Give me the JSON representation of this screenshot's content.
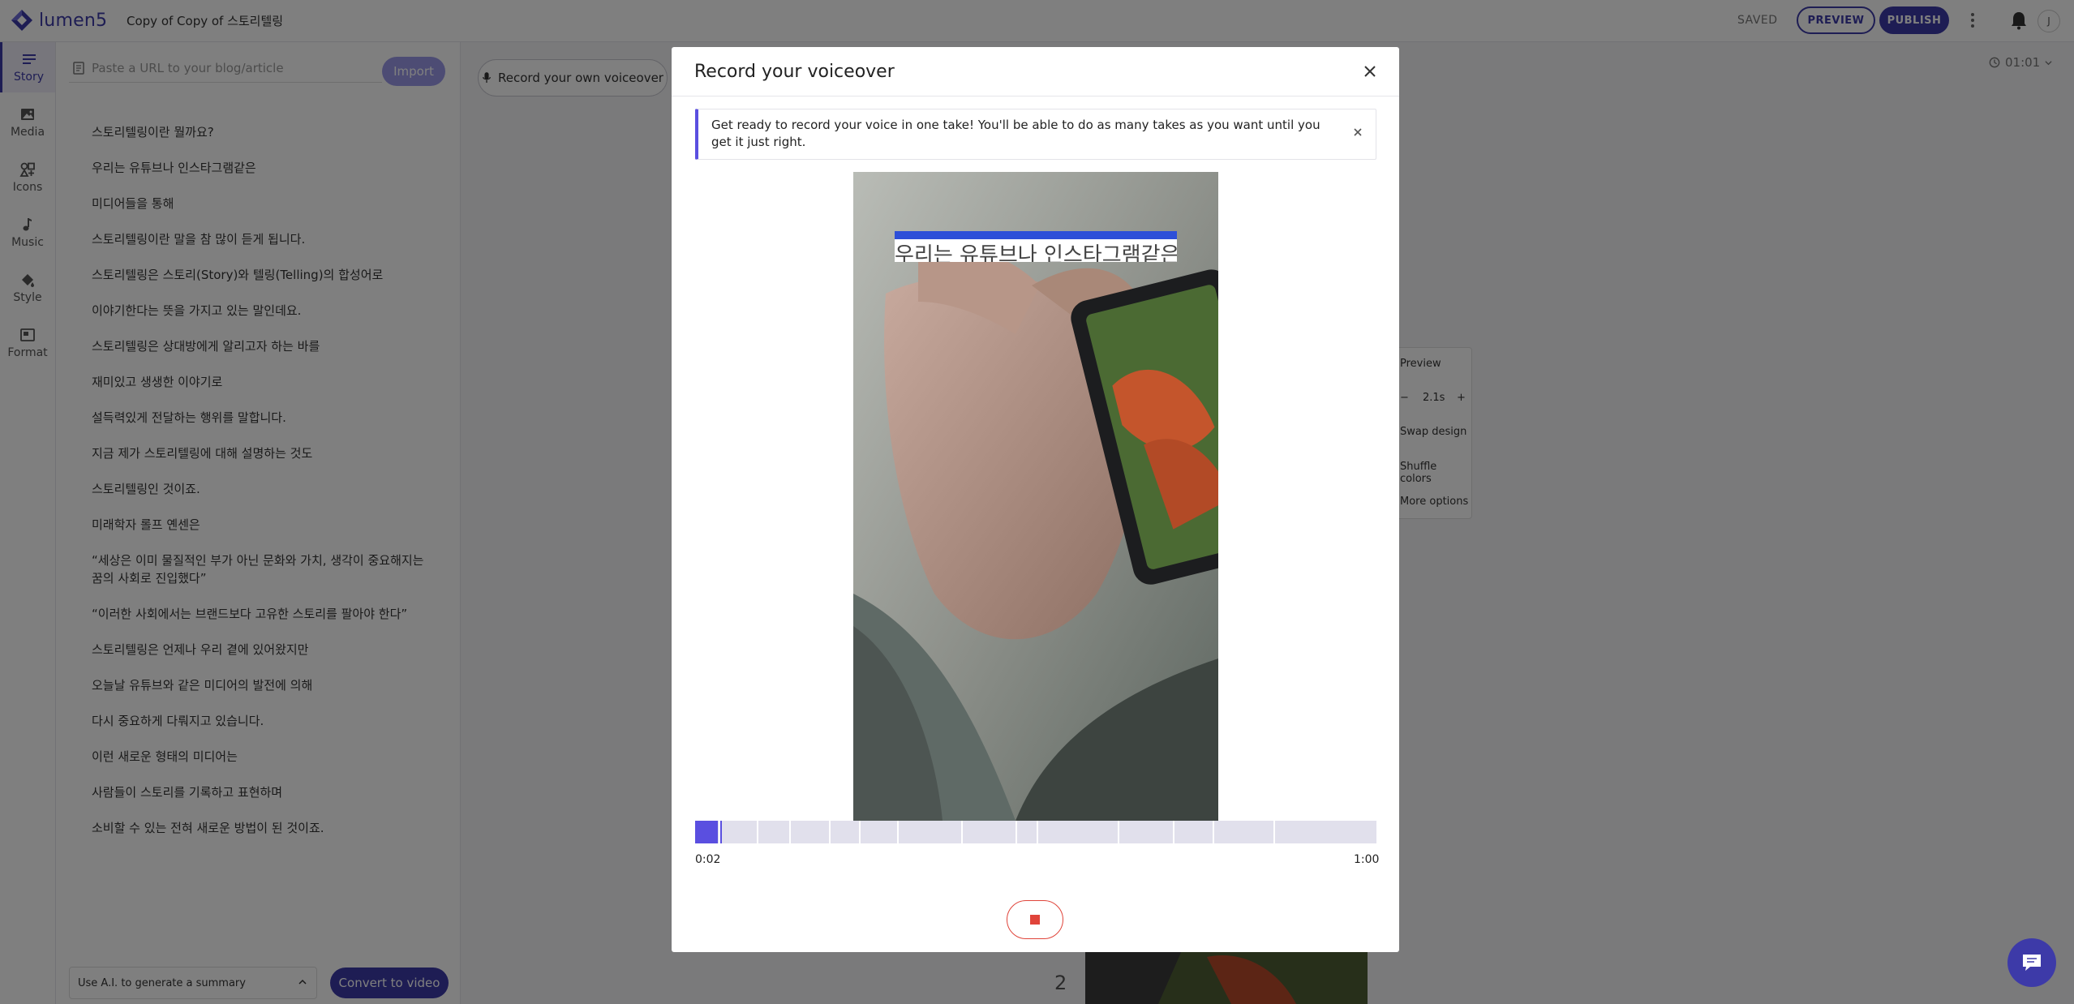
{
  "app": {
    "logo_text": "lumen5",
    "doc_title": "Copy of Copy of 스토리텔링",
    "saved_label": "SAVED",
    "preview_label": "PREVIEW",
    "publish_label": "PUBLISH",
    "avatar_initial": "J",
    "brand_color": "#3d3aa8"
  },
  "leftnav": {
    "items": [
      {
        "label": "Story",
        "icon": "story-lines-icon"
      },
      {
        "label": "Media",
        "icon": "image-icon"
      },
      {
        "label": "Icons",
        "icon": "shapes-icon"
      },
      {
        "label": "Music",
        "icon": "music-note-icon"
      },
      {
        "label": "Style",
        "icon": "paint-drop-icon"
      },
      {
        "label": "Format",
        "icon": "format-frame-icon"
      }
    ]
  },
  "story": {
    "url_placeholder": "Paste a URL to your blog/article",
    "import_label": "Import",
    "lines": [
      "스토리텔링이란 뭘까요?",
      "우리는 유튜브나 인스타그램같은",
      "미디어들을 통해",
      "스토리텔링이란 말을 참 많이 듣게 됩니다.",
      "스토리텔링은 스토리(Story)와 텔링(Telling)의 합성어로",
      "이야기한다는 뜻을 가지고 있는 말인데요.",
      "스토리텔링은 상대방에게 알리고자 하는 바를",
      "재미있고 생생한 이야기로",
      "설득력있게 전달하는 행위를 말합니다.",
      "지금 제가 스토리텔링에 대해 설명하는 것도",
      "스토리텔링인 것이죠.",
      "미래학자 롤프 옌센은",
      "“세상은 이미 물질적인 부가 아닌 문화와 가치, 생각이 중요해지는 꿈의 사회로 진입했다”",
      "“이러한 사회에서는 브랜드보다 고유한 스토리를 팔아야 한다”",
      "스토리텔링은 언제나 우리 곁에 있어왔지만",
      "오늘날 유튜브와 같은 미디어의 발전에 의해",
      "다시 중요하게 다뤄지고 있습니다.",
      "이런 새로운 형태의 미디어는",
      "사람들이 스토리를 기록하고 표현하며",
      "소비할 수 있는 전혀 새로운 방법이 된 것이죠."
    ],
    "ai_select_label": "Use A.I. to generate a summary",
    "convert_label": "Convert to video"
  },
  "canvas": {
    "record_own_label": "Record your own voiceover",
    "timer": "01:01",
    "side_menu": {
      "preview": "Preview",
      "minus": "−",
      "duration": "2.1s",
      "plus": "+",
      "swap": "Swap design",
      "shuffle": "Shuffle colors",
      "more": "More options"
    },
    "scene_number": "2"
  },
  "modal": {
    "title": "Record your voiceover",
    "notice": "Get ready to record your voice in one take! You'll be able to do as many takes as you want until you get it just right.",
    "caption": "우리는 유튜브나 인스타그램같은",
    "elapsed": "0:02",
    "total": "1:00",
    "progress_fraction": 0.033,
    "segment_breaks": [
      0.035,
      0.091,
      0.138,
      0.197,
      0.24,
      0.297,
      0.39,
      0.47,
      0.501,
      0.62,
      0.701,
      0.76,
      0.849
    ],
    "record_color": "#e0443a",
    "accent_color": "#5a4fe0"
  }
}
